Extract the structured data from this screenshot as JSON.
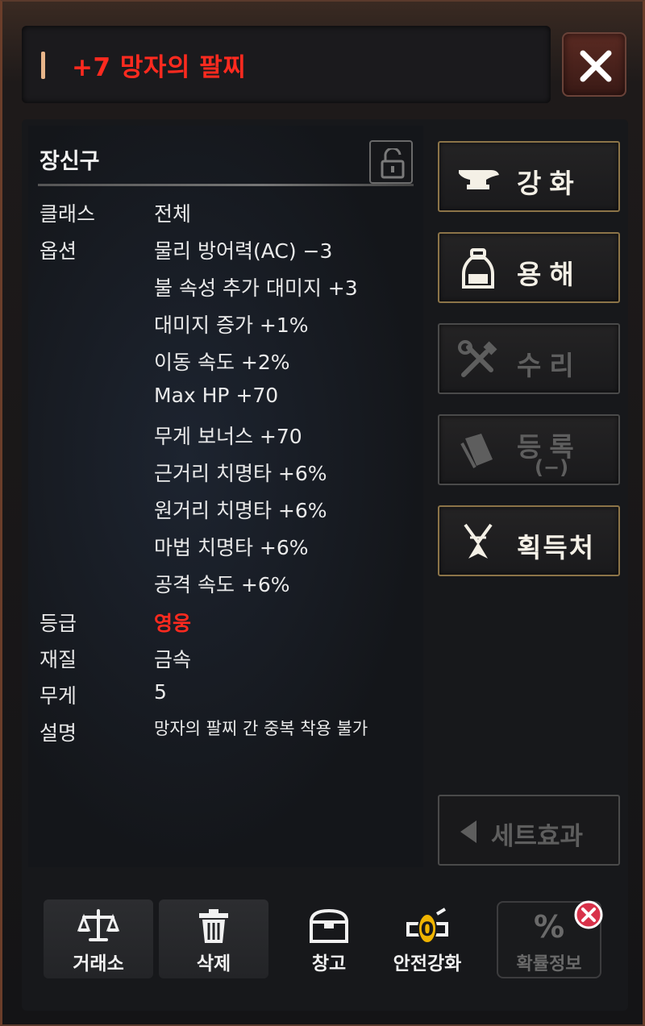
{
  "title": {
    "text": "+7 망자의 팔찌",
    "close_icon": "close-x-icon"
  },
  "item": {
    "category": "장신구",
    "lock_icon": "unlocked-padlock-icon",
    "class_label": "클래스",
    "class_value": "전체",
    "option_label": "옵션",
    "options": [
      "물리 방어력(AC) −3",
      "불 속성 추가 대미지 +3",
      "대미지 증가 +1%",
      "이동 속도 +2%",
      "Max HP +70",
      "무게 보너스 +70",
      "근거리 치명타 +6%",
      "원거리 치명타 +6%",
      "마법 치명타 +6%",
      "공격 속도 +6%"
    ],
    "grade_label": "등급",
    "grade_value": "영웅",
    "material_label": "재질",
    "material_value": "금속",
    "weight_label": "무게",
    "weight_value": "5",
    "desc_label": "설명",
    "desc_value": "망자의 팔찌 간 중복 착용 불가"
  },
  "side_buttons": {
    "enhance": "강화",
    "dissolve": "용해",
    "repair": "수리",
    "register": "등록",
    "register_sub": "(−)",
    "obtain": "획득처",
    "set_effect": "세트효과"
  },
  "bottom_buttons": {
    "exchange": "거래소",
    "delete": "삭제",
    "storage": "창고",
    "safe_enhance": "안전강화",
    "safe_enhance_badge": "0",
    "probability": "확률정보",
    "probability_symbol": "%"
  },
  "colors": {
    "title_red": "#ff2a1f",
    "gold_border": "#8c7448",
    "disabled_gray": "#5e5e5e"
  }
}
